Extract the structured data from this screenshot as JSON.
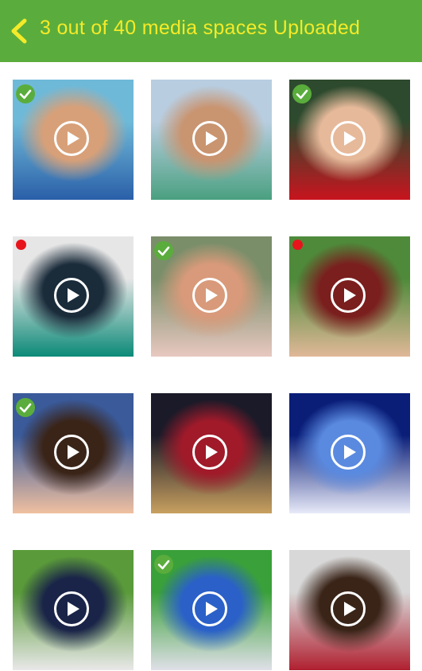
{
  "header": {
    "title": "3 out of 40 media spaces Uploaded",
    "back_icon": "chevron-left-icon",
    "background": "#5aad3c",
    "title_color": "#f4ea2a"
  },
  "colors": {
    "uploaded_badge": "#5aad3c",
    "pending_dot": "#e8141c"
  },
  "media": [
    {
      "name": "media-tile-beach-group",
      "status": "uploaded",
      "colors": [
        "#6fb9d8",
        "#d8a078",
        "#2a5fa8"
      ]
    },
    {
      "name": "media-tile-beach-friends",
      "status": "none",
      "colors": [
        "#b8cde0",
        "#c99470",
        "#4aa080"
      ]
    },
    {
      "name": "media-tile-toddler-tutu",
      "status": "uploaded",
      "colors": [
        "#2e4a2e",
        "#e6b99a",
        "#c8141e"
      ]
    },
    {
      "name": "media-tile-kids-snow",
      "status": "pending",
      "colors": [
        "#e6e6e6",
        "#1a2b3a",
        "#0c8a78"
      ]
    },
    {
      "name": "media-tile-soldier-baby",
      "status": "uploaded",
      "colors": [
        "#7a8e6a",
        "#d89a7a",
        "#e8c8c0"
      ]
    },
    {
      "name": "media-tile-stadium-fans",
      "status": "pending",
      "colors": [
        "#4e8a3a",
        "#7a1e1e",
        "#e0b898"
      ]
    },
    {
      "name": "media-tile-birthday-girl",
      "status": "uploaded",
      "colors": [
        "#3a5a9a",
        "#3a2418",
        "#f0c0a0"
      ]
    },
    {
      "name": "media-tile-volleyball",
      "status": "none",
      "colors": [
        "#1a1a28",
        "#a01a2a",
        "#c8a060"
      ]
    },
    {
      "name": "media-tile-castle",
      "status": "none",
      "colors": [
        "#0a1e78",
        "#5a8ae0",
        "#e8eaf8"
      ]
    },
    {
      "name": "media-tile-egg-hunt",
      "status": "none",
      "colors": [
        "#5a9a3a",
        "#1a2448",
        "#e8e8e8"
      ]
    },
    {
      "name": "media-tile-soccer-girls",
      "status": "uploaded",
      "colors": [
        "#3aa03a",
        "#2a60c8",
        "#e0e0e8"
      ]
    },
    {
      "name": "media-tile-kids-selfie",
      "status": "none",
      "colors": [
        "#d8d8d8",
        "#3a2418",
        "#b02030"
      ]
    }
  ]
}
